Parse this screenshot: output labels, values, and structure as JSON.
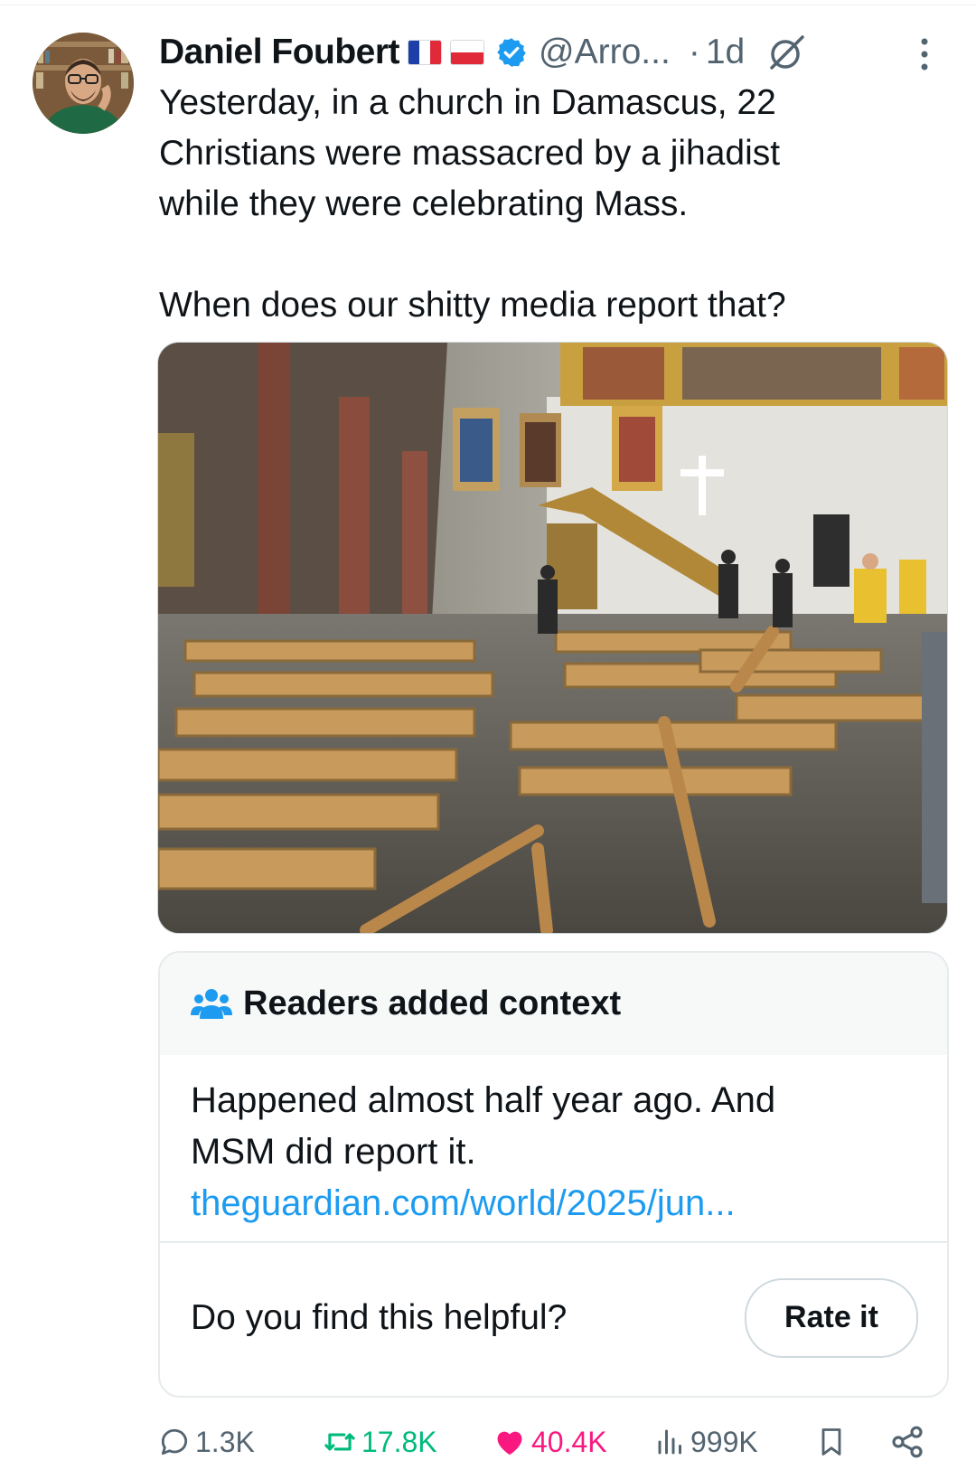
{
  "author": {
    "name": "Daniel Foubert",
    "handle": "@Arro...",
    "time": "1d",
    "flags": [
      "flag-france",
      "flag-poland"
    ]
  },
  "tweet": {
    "text": "Yesterday, in a church in Damascus, 22\nChristians were massacred by a jihadist\nwhile they were celebrating Mass.\n\nWhen does our shitty media report that?"
  },
  "community_note": {
    "title": "Readers added context",
    "body": "Happened almost half year ago. And\nMSM did report it.",
    "link": "theguardian.com/world/2025/jun...",
    "prompt": "Do you find this helpful?",
    "rate_label": "Rate it"
  },
  "actions": {
    "replies": "1.3K",
    "reposts": "17.8K",
    "likes": "40.4K",
    "views": "999K"
  },
  "colors": {
    "accent": "#1d9bf0",
    "repost": "#00ba7c",
    "like": "#f91880",
    "secondary_text": "#536471"
  }
}
